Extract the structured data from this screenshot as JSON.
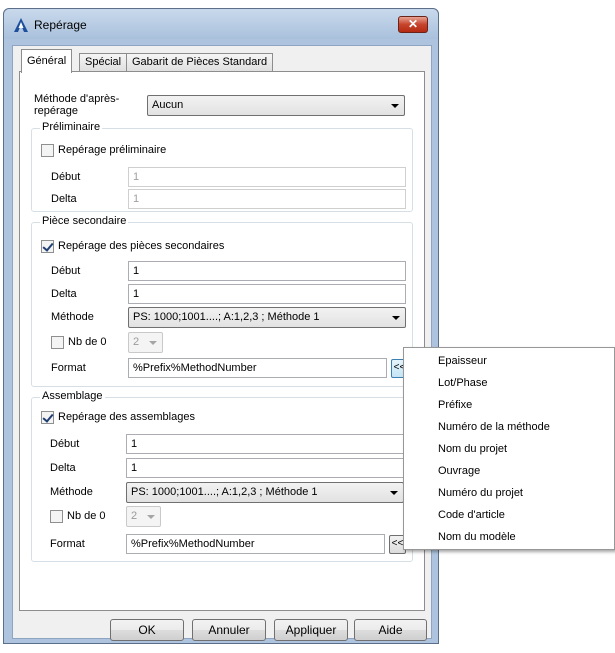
{
  "window": {
    "title": "Repérage",
    "close_label": "✕"
  },
  "tabs": [
    "Général",
    "Spécial",
    "Gabarit de Pièces Standard"
  ],
  "method": {
    "label": "Méthode d'après-repérage",
    "value": "Aucun"
  },
  "preliminaire": {
    "title": "Préliminaire",
    "checkbox_label": "Repérage préliminaire",
    "checked": false,
    "debut_label": "Début",
    "debut_value": "1",
    "delta_label": "Delta",
    "delta_value": "1"
  },
  "secondaire": {
    "title": "Pièce secondaire",
    "checkbox_label": "Repérage des pièces secondaires",
    "checked": true,
    "debut_label": "Début",
    "debut_value": "1",
    "delta_label": "Delta",
    "delta_value": "1",
    "methode_label": "Méthode",
    "methode_value": "PS: 1000;1001....; A:1,2,3 ; Méthode 1",
    "nb_label": "Nb de 0",
    "nb_value": "2",
    "format_label": "Format",
    "format_value": "%Prefix%MethodNumber",
    "format_button": "<<"
  },
  "assemblage": {
    "title": "Assemblage",
    "checkbox_label": "Repérage des assemblages",
    "checked": true,
    "debut_label": "Début",
    "debut_value": "1",
    "delta_label": "Delta",
    "delta_value": "1",
    "methode_label": "Méthode",
    "methode_value": "PS: 1000;1001....; A:1,2,3 ; Méthode 1",
    "nb_label": "Nb de 0",
    "nb_value": "2",
    "format_label": "Format",
    "format_value": "%Prefix%MethodNumber",
    "format_button": "<<"
  },
  "buttons": {
    "ok": "OK",
    "cancel": "Annuler",
    "apply": "Appliquer",
    "help": "Aide"
  },
  "menu": {
    "items": [
      "Epaisseur",
      "Lot/Phase",
      "Préfixe",
      "Numéro de la méthode",
      "Nom du projet",
      "Ouvrage",
      "Numéro du projet",
      "Code d'article",
      "Nom du modèle"
    ]
  },
  "colors": {
    "title_bar": "#aec4de",
    "close_button": "#c7442c",
    "accent": "#3c7fb1"
  }
}
